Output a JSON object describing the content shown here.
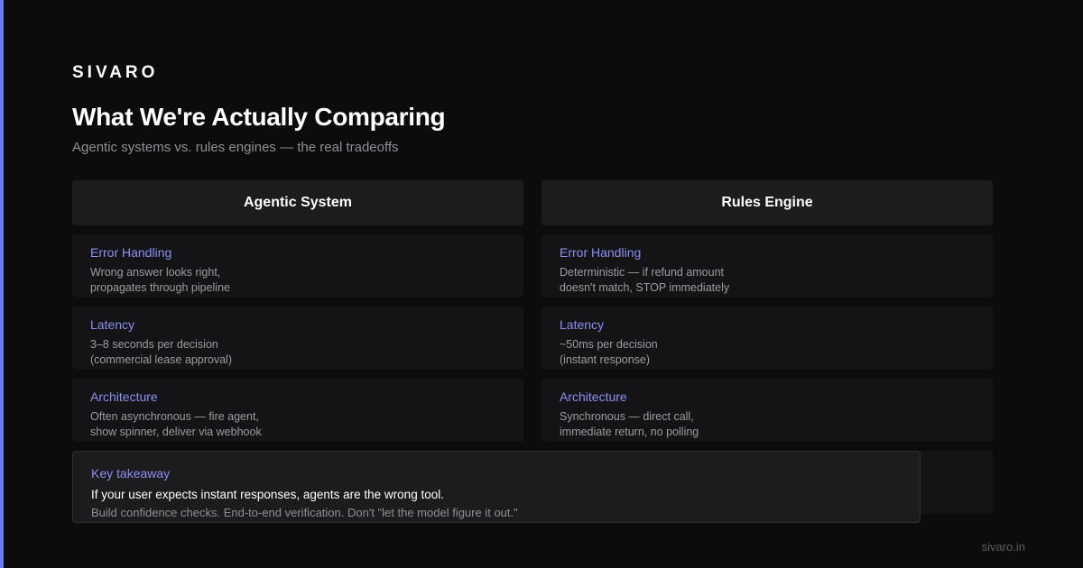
{
  "brand": "SIVARO",
  "title": "What We're Actually Comparing",
  "subtitle": "Agentic systems vs. rules engines — the real tradeoffs",
  "columns": [
    {
      "header": "Agentic System",
      "cards": [
        {
          "label": "Error Handling",
          "line1": "Wrong answer looks right,",
          "line2": "propagates through pipeline"
        },
        {
          "label": "Latency",
          "line1": "3–8 seconds per decision",
          "line2": "(commercial lease approval)"
        },
        {
          "label": "Architecture",
          "line1": "Often asynchronous — fire agent,",
          "line2": "show spinner, deliver via webhook"
        }
      ]
    },
    {
      "header": "Rules Engine",
      "cards": [
        {
          "label": "Error Handling",
          "line1": "Deterministic — if refund amount",
          "line2": "doesn't match, STOP immediately"
        },
        {
          "label": "Latency",
          "line1": "~50ms per decision",
          "line2": "(instant response)"
        },
        {
          "label": "Architecture",
          "line1": "Synchronous — direct call,",
          "line2": "immediate return, no polling"
        }
      ]
    }
  ],
  "takeaway": {
    "label": "Key takeaway",
    "main": "If your user expects instant responses, agents are the wrong tool.",
    "sub": "Build confidence checks. End-to-end verification. Don't \"let the model figure it out.\""
  },
  "footer": "sivaro.in",
  "colors": {
    "accent": "#6c78ee",
    "label": "#8a8ff0",
    "background": "#0c0c0d",
    "card": "#141416",
    "header": "#1c1c1f"
  }
}
